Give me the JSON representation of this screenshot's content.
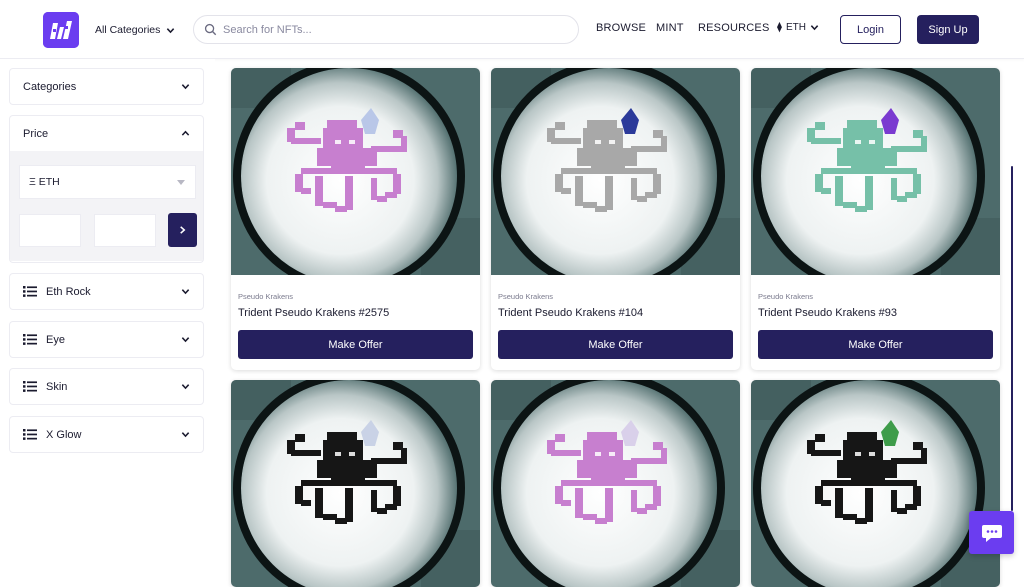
{
  "header": {
    "categories_label": "All Categories",
    "search_placeholder": "Search for NFTs...",
    "nav": [
      "BROWSE",
      "MINT",
      "RESOURCES"
    ],
    "currency_symbol": "⧫",
    "currency": "ETH",
    "login_label": "Login",
    "signup_label": "Sign Up",
    "icons": {
      "logo": "logo-icon",
      "search": "search-icon",
      "dropdown": "chevron-down-icon"
    }
  },
  "sidebar": {
    "categories_label": "Categories",
    "price": {
      "label": "Price",
      "currency_option": "Ξ ETH",
      "min_value": "",
      "max_value": "",
      "range_separator": "-"
    },
    "trait_filters": [
      "Eth Rock",
      "Eye",
      "Skin",
      "X Glow"
    ]
  },
  "grid": {
    "cards": [
      {
        "collection": "Pseudo Krakens",
        "name": "Trident Pseudo Krakens #2575",
        "button": "Make Offer",
        "kraken_color": "#c77fcf",
        "gem_color": "#b9c7e8"
      },
      {
        "collection": "Pseudo Krakens",
        "name": "Trident Pseudo Krakens #104",
        "button": "Make Offer",
        "kraken_color": "#a8a8a8",
        "gem_color": "#2b3a9a"
      },
      {
        "collection": "Pseudo Krakens",
        "name": "Trident Pseudo Krakens #93",
        "button": "Make Offer",
        "kraken_color": "#76c0a8",
        "gem_color": "#7a3ad0"
      },
      {
        "collection": "",
        "name": "",
        "button": "",
        "kraken_color": "#161616",
        "gem_color": "#c9d2e6"
      },
      {
        "collection": "",
        "name": "",
        "button": "",
        "kraken_color": "#c77fcf",
        "gem_color": "#d9d0ea"
      },
      {
        "collection": "",
        "name": "",
        "button": "",
        "kraken_color": "#161616",
        "gem_color": "#3e9c4a"
      }
    ]
  },
  "colors": {
    "brand_purple": "#6b3df0",
    "navy": "#25205e",
    "art_teal": "#4d6b6b"
  },
  "chat": {
    "icon": "chat-icon"
  }
}
